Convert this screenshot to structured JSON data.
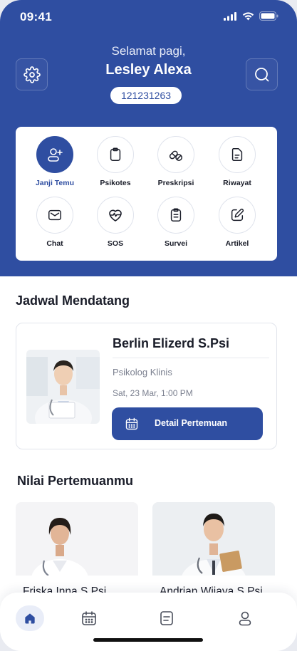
{
  "status_bar": {
    "time": "09:41"
  },
  "header": {
    "greeting": "Selamat pagi,",
    "user_name": "Lesley Alexa",
    "user_id": "121231263",
    "settings_icon": "gear-icon",
    "search_icon": "search-icon"
  },
  "menu": {
    "items": [
      {
        "label": "Janji Temu",
        "icon": "user-plus-icon",
        "active": true
      },
      {
        "label": "Psikotes",
        "icon": "clipboard-icon"
      },
      {
        "label": "Preskripsi",
        "icon": "pills-icon"
      },
      {
        "label": "Riwayat",
        "icon": "document-icon"
      },
      {
        "label": "Chat",
        "icon": "mail-icon"
      },
      {
        "label": "SOS",
        "icon": "heart-pulse-icon"
      },
      {
        "label": "Survei",
        "icon": "survey-icon"
      },
      {
        "label": "Artikel",
        "icon": "edit-icon"
      }
    ]
  },
  "upcoming": {
    "title": "Jadwal Mendatang",
    "doctor_name": "Berlin Elizerd S.Psi",
    "role": "Psikolog Klinis",
    "datetime": "Sat, 23 Mar, 1:00 PM",
    "button_label": "Detail Pertemuan"
  },
  "ratings": {
    "title": "Nilai Pertemuanmu",
    "doctors": [
      {
        "name": "Friska Inna S.Psi"
      },
      {
        "name": "Andrian Wijaya S.Psi"
      }
    ]
  },
  "bottom_nav": {
    "items": [
      {
        "icon": "home-icon",
        "active": true
      },
      {
        "icon": "calendar-icon"
      },
      {
        "icon": "document-list-icon"
      },
      {
        "icon": "profile-icon"
      }
    ]
  },
  "colors": {
    "primary": "#2f4ea1",
    "text": "#1a1d29",
    "muted": "#7c8190"
  }
}
